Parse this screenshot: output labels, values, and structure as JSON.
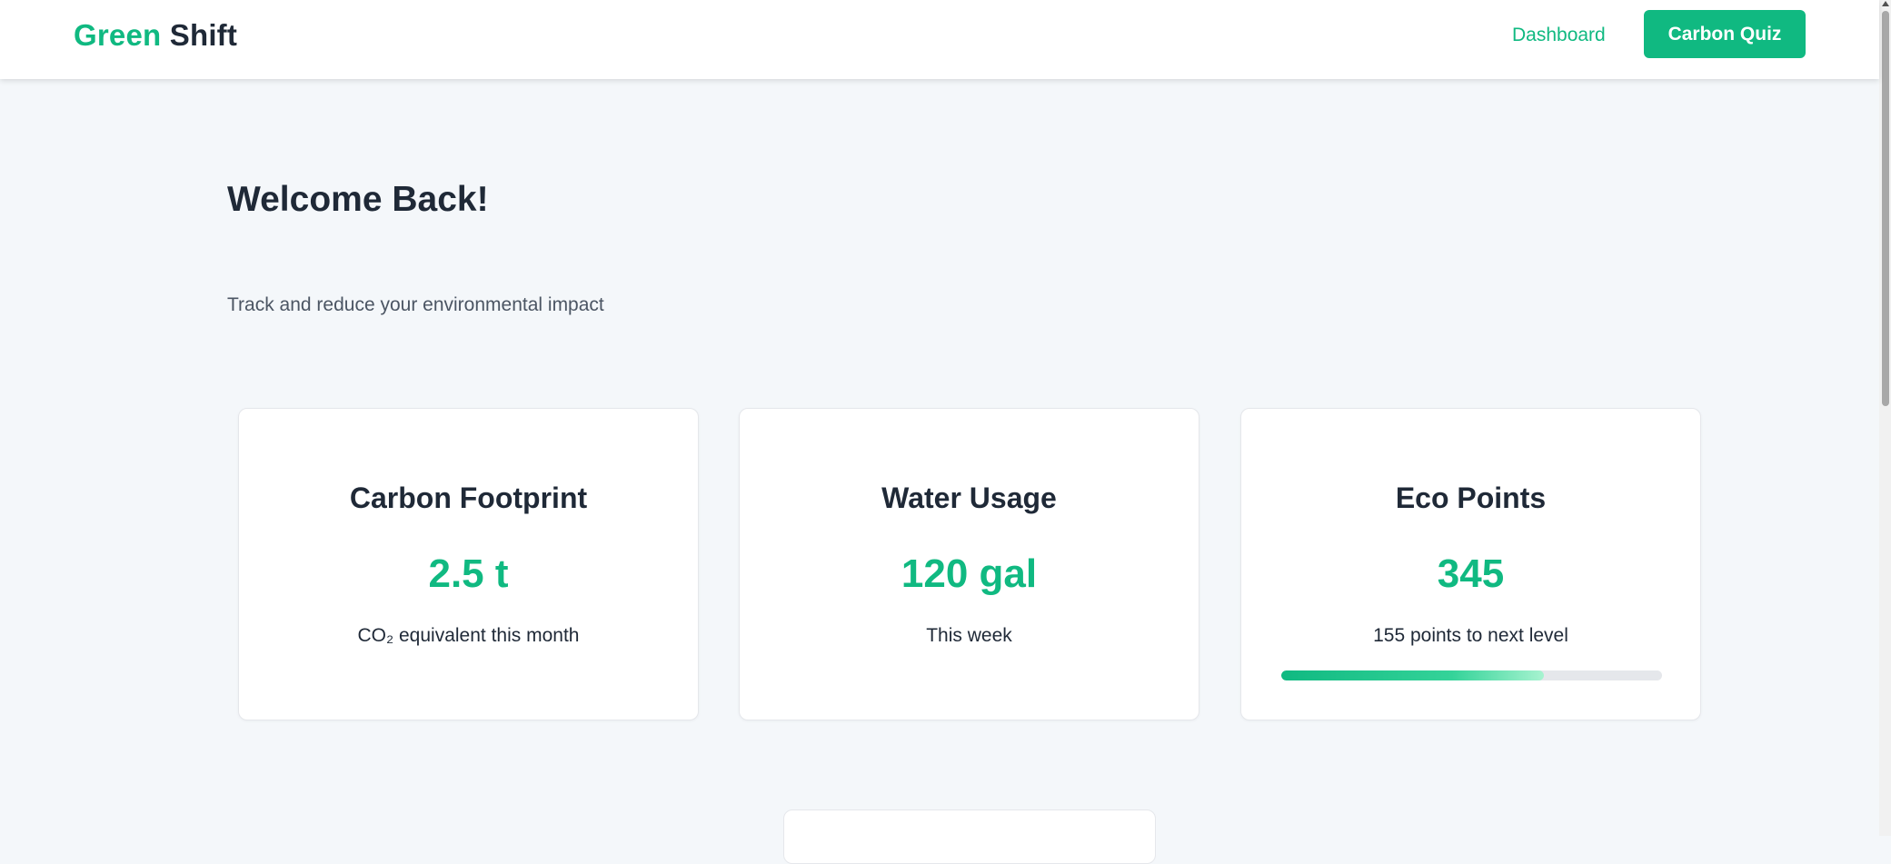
{
  "navbar": {
    "logo_green": "Green",
    "logo_dark": "Shift",
    "dashboard_link": "Dashboard",
    "quiz_button": "Carbon Quiz"
  },
  "header": {
    "title": "Welcome Back!",
    "subtitle": "Track and reduce your environmental impact"
  },
  "cards": [
    {
      "title": "Carbon Footprint",
      "value": "2.5 t",
      "note": "CO₂ equivalent this month"
    },
    {
      "title": "Water Usage",
      "value": "120 gal",
      "note": "This week"
    },
    {
      "title": "Eco Points",
      "value": "345",
      "note": "155 points to next level",
      "progress_percent": 69
    }
  ],
  "colors": {
    "accent": "#10b981",
    "text": "#1f2937",
    "muted": "#4b5563",
    "background": "#f4f7fa"
  }
}
